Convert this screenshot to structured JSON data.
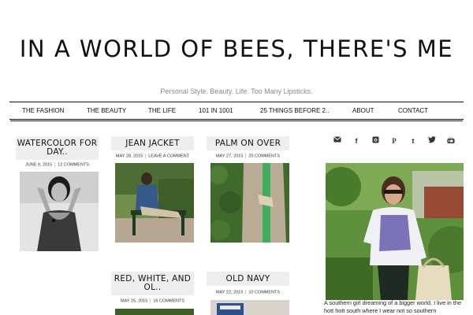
{
  "header": {
    "title": "IN A WORLD OF BEES, THERE'S ME",
    "tagline": "Personal Style. Beauty. Life. Too Many Lipsticks."
  },
  "nav": {
    "items": [
      "THE FASHION",
      "THE BEAUTY",
      "THE LIFE",
      "101 IN 1001",
      "25 THINGS BEFORE 2..",
      "ABOUT",
      "CONTACT"
    ]
  },
  "posts": [
    {
      "title": "WATERCOLOR FOR DAY..",
      "date": "JUNE 9, 2015",
      "comments": "12 COMMENTS"
    },
    {
      "title": "JEAN JACKET",
      "date": "MAY 28, 2015",
      "comments": "LEAVE A COMMENT"
    },
    {
      "title": "PALM ON OVER",
      "date": "MAY 27, 2015",
      "comments": "20 COMMENTS"
    },
    {
      "title": "RED, WHITE, AND OL..",
      "date": "MAY 25, 2015",
      "comments": "16 COMMENTS"
    },
    {
      "title": "OLD NAVY",
      "date": "MAY 22, 2015",
      "comments": "10 COMMENTS"
    }
  ],
  "sidebar": {
    "social_icons": [
      "mail-icon",
      "facebook-icon",
      "instagram-icon",
      "pinterest-icon",
      "tumblr-icon",
      "twitter-icon",
      "youtube-icon"
    ],
    "about_text": "A southern girl dreaming of a bigger world. I live in the hott hott south where I wear not so southern"
  }
}
